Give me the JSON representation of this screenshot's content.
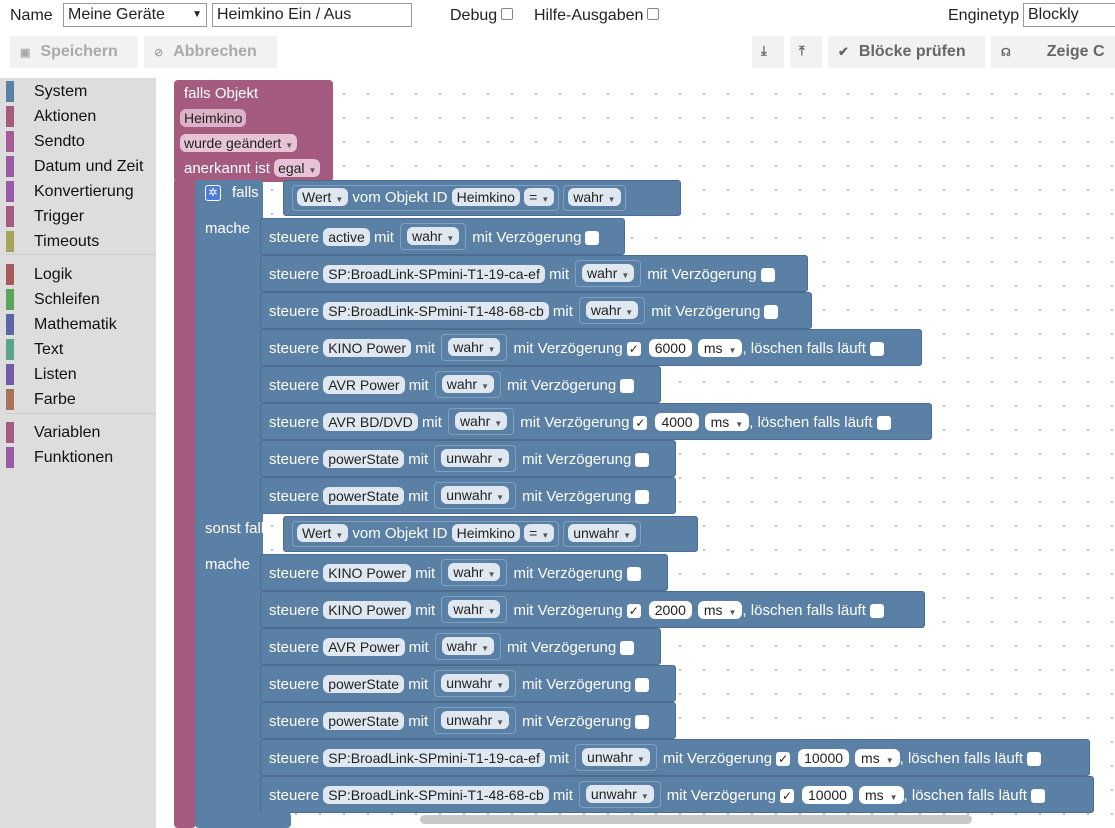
{
  "header": {
    "name_label": "Name",
    "group_value": "Meine Geräte",
    "script_name": "Heimkino Ein / Aus",
    "debug_label": "Debug",
    "help_label": "Hilfe-Ausgaben",
    "enginetype_label": "Enginetyp",
    "enginetype_value": "Blockly"
  },
  "toolbar": {
    "save": "Speichern",
    "cancel": "Abbrechen",
    "export": "⤓",
    "import": "⤒",
    "check": "Blöcke prüfen",
    "show_code": "Zeige C"
  },
  "sidebar": {
    "categories": [
      {
        "label": "System",
        "color": "#5b80a5"
      },
      {
        "label": "Aktionen",
        "color": "#a55b80"
      },
      {
        "label": "Sendto",
        "color": "#a55b99"
      },
      {
        "label": "Datum und Zeit",
        "color": "#995ba5"
      },
      {
        "label": "Konvertierung",
        "color": "#995ba5"
      },
      {
        "label": "Trigger",
        "color": "#a55b80"
      },
      {
        "label": "Timeouts",
        "color": "#a5a55b"
      },
      {
        "label": "Logik",
        "color": "#a55b5b"
      },
      {
        "label": "Schleifen",
        "color": "#5ba55b"
      },
      {
        "label": "Mathematik",
        "color": "#5b67a5"
      },
      {
        "label": "Text",
        "color": "#5ba58c"
      },
      {
        "label": "Listen",
        "color": "#745ba5"
      },
      {
        "label": "Farbe",
        "color": "#a5745b"
      },
      {
        "label": "Variablen",
        "color": "#a55b80"
      },
      {
        "label": "Funktionen",
        "color": "#995ba5"
      }
    ]
  },
  "trigger": {
    "title": "falls Objekt",
    "object": "Heimkino",
    "event": "wurde geändert",
    "ack_label": "anerkannt ist",
    "ack_value": "egal"
  },
  "if_block": {
    "if_label": "falls",
    "do_label": "mache",
    "elseif_label": "sonst falls",
    "condition1": {
      "prop": "Wert",
      "mid": "vom Objekt ID",
      "obj": "Heimkino",
      "op": "=",
      "val": "wahr"
    },
    "condition2": {
      "prop": "Wert",
      "mid": "vom Objekt ID",
      "obj": "Heimkino",
      "op": "=",
      "val": "unwahr"
    }
  },
  "words": {
    "steuere": "steuere",
    "mit": "mit",
    "delay": "mit Verzögerung",
    "clear": ", löschen falls läuft",
    "check": "✓"
  },
  "commands1": [
    {
      "obj": "active",
      "val": "wahr",
      "delay": false
    },
    {
      "obj": "SP:BroadLink-SPmini-T1-19-ca-ef",
      "val": "wahr",
      "delay": false
    },
    {
      "obj": "SP:BroadLink-SPmini-T1-48-68-cb",
      "val": "wahr",
      "delay": false
    },
    {
      "obj": "KINO Power",
      "val": "wahr",
      "delay": true,
      "ms": "6000",
      "unit": "ms"
    },
    {
      "obj": "AVR Power",
      "val": "wahr",
      "delay": false
    },
    {
      "obj": "AVR BD/DVD",
      "val": "wahr",
      "delay": true,
      "ms": "4000",
      "unit": "ms"
    },
    {
      "obj": "powerState",
      "val": "unwahr",
      "delay": false
    },
    {
      "obj": "powerState",
      "val": "unwahr",
      "delay": false
    }
  ],
  "commands2": [
    {
      "obj": "KINO Power",
      "val": "wahr",
      "delay": false
    },
    {
      "obj": "KINO Power",
      "val": "wahr",
      "delay": true,
      "ms": "2000",
      "unit": "ms"
    },
    {
      "obj": "AVR Power",
      "val": "wahr",
      "delay": false
    },
    {
      "obj": "powerState",
      "val": "unwahr",
      "delay": false
    },
    {
      "obj": "powerState",
      "val": "unwahr",
      "delay": false
    },
    {
      "obj": "SP:BroadLink-SPmini-T1-19-ca-ef",
      "val": "unwahr",
      "delay": true,
      "ms": "10000",
      "unit": "ms"
    },
    {
      "obj": "SP:BroadLink-SPmini-T1-48-68-cb",
      "val": "unwahr",
      "delay": true,
      "ms": "10000",
      "unit": "ms"
    }
  ]
}
